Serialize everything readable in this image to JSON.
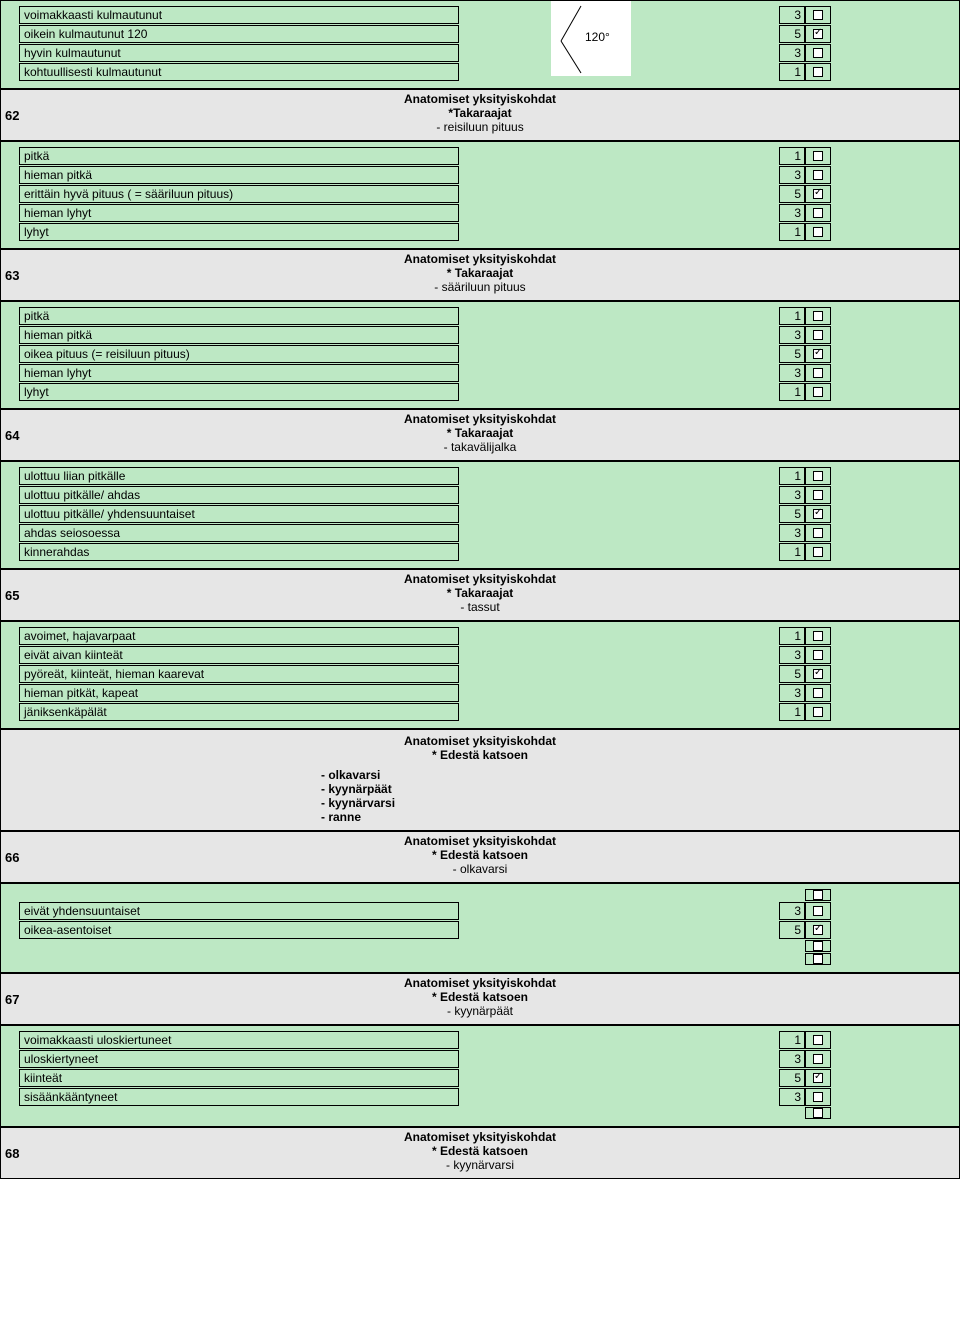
{
  "angleLabel": "120°",
  "topBlock": {
    "options": [
      {
        "label": "voimakkaasti kulmautunut",
        "score": "3",
        "checked": false
      },
      {
        "label": "oikein kulmautunut 120",
        "score": "5",
        "checked": true
      },
      {
        "label": "hyvin kulmautunut",
        "score": "3",
        "checked": false
      },
      {
        "label": "kohtuullisesti kulmautunut",
        "score": "1",
        "checked": false
      }
    ]
  },
  "sections": [
    {
      "num": "62",
      "h1": "Anatomiset yksityiskohdat",
      "h2": "*Takaraajat",
      "h3": "- reisiluun pituus",
      "options": [
        {
          "label": "pitkä",
          "score": "1",
          "checked": false
        },
        {
          "label": "hieman pitkä",
          "score": "3",
          "checked": false
        },
        {
          "label": "erittäin hyvä pituus ( = sääriluun pituus)",
          "score": "5",
          "checked": true
        },
        {
          "label": "hieman lyhyt",
          "score": "3",
          "checked": false
        },
        {
          "label": "lyhyt",
          "score": "1",
          "checked": false
        }
      ]
    },
    {
      "num": "63",
      "h1": "Anatomiset yksityiskohdat",
      "h2": "* Takaraajat",
      "h3": "- sääriluun pituus",
      "options": [
        {
          "label": "pitkä",
          "score": "1",
          "checked": false
        },
        {
          "label": "hieman pitkä",
          "score": "3",
          "checked": false
        },
        {
          "label": "oikea pituus (= reisiluun pituus)",
          "score": "5",
          "checked": true
        },
        {
          "label": "hieman lyhyt",
          "score": "3",
          "checked": false
        },
        {
          "label": "lyhyt",
          "score": "1",
          "checked": false
        }
      ]
    },
    {
      "num": "64",
      "h1": "Anatomiset yksityiskohdat",
      "h2": "* Takaraajat",
      "h3": "- takavälijalka",
      "options": [
        {
          "label": "ulottuu liian pitkälle",
          "score": "1",
          "checked": false
        },
        {
          "label": "ulottuu pitkälle/ ahdas",
          "score": "3",
          "checked": false
        },
        {
          "label": "ulottuu pitkälle/ yhdensuuntaiset",
          "score": "5",
          "checked": true
        },
        {
          "label": "ahdas seiosoessa",
          "score": "3",
          "checked": false
        },
        {
          "label": "kinnerahdas",
          "score": "1",
          "checked": false
        }
      ]
    },
    {
      "num": "65",
      "h1": "Anatomiset yksityiskohdat",
      "h2": "* Takaraajat",
      "h3": "- tassut",
      "options": [
        {
          "label": "avoimet, hajavarpaat",
          "score": "1",
          "checked": false
        },
        {
          "label": "eivät aivan kiinteät",
          "score": "3",
          "checked": false
        },
        {
          "label": "pyöreät, kiinteät, hieman kaarevat",
          "score": "5",
          "checked": true
        },
        {
          "label": "hieman pitkät, kapeat",
          "score": "3",
          "checked": false
        },
        {
          "label": "jäniksenkäpälät",
          "score": "1",
          "checked": false
        }
      ]
    }
  ],
  "frontHeader": {
    "h1": "Anatomiset yksityiskohdat",
    "h2": "* Edestä katsoen",
    "list": [
      "- olkavarsi",
      "- kyynärpäät",
      "- kyynärvarsi",
      "- ranne"
    ]
  },
  "section66": {
    "num": "66",
    "h1": "Anatomiset yksityiskohdat",
    "h2": "* Edestä katsoen",
    "h3": "- olkavarsi",
    "options": [
      {
        "label": "",
        "score": "",
        "checked": false
      },
      {
        "label": "eivät yhdensuuntaiset",
        "score": "3",
        "checked": false
      },
      {
        "label": "oikea-asentoiset",
        "score": "5",
        "checked": true
      },
      {
        "label": "",
        "score": "",
        "checked": false
      },
      {
        "label": "",
        "score": "",
        "checked": false
      }
    ]
  },
  "section67": {
    "num": "67",
    "h1": "Anatomiset yksityiskohdat",
    "h2": "* Edestä katsoen",
    "h3": "- kyynärpäät",
    "options": [
      {
        "label": "voimakkaasti uloskiertuneet",
        "score": "1",
        "checked": false
      },
      {
        "label": "uloskiertyneet",
        "score": "3",
        "checked": false
      },
      {
        "label": "kiinteät",
        "score": "5",
        "checked": true
      },
      {
        "label": "sisäänkääntyneet",
        "score": "3",
        "checked": false
      },
      {
        "label": "",
        "score": "",
        "checked": false
      }
    ]
  },
  "section68": {
    "num": "68",
    "h1": "Anatomiset yksityiskohdat",
    "h2": "* Edestä katsoen",
    "h3": "- kyynärvarsi"
  }
}
